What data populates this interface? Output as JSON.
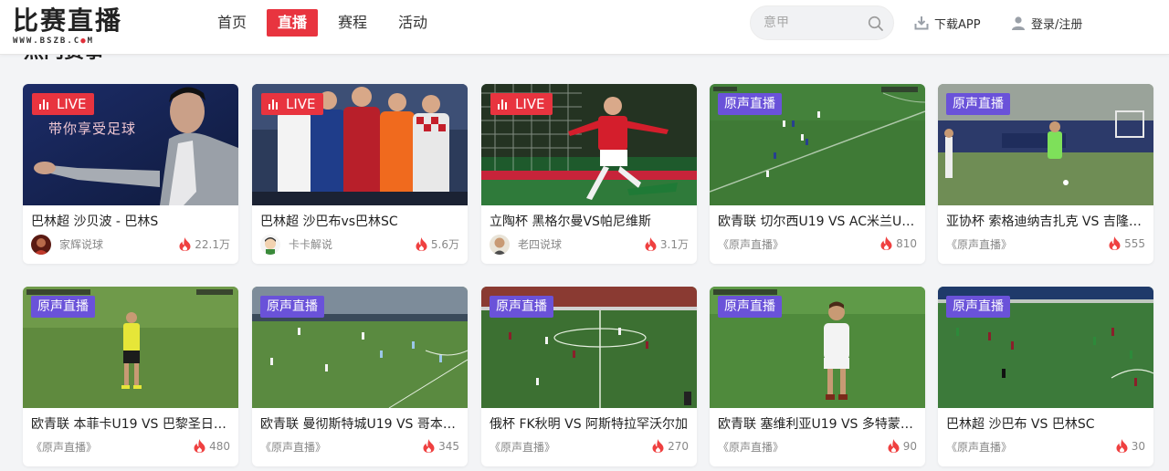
{
  "header": {
    "logo_title": "比赛直播",
    "logo_url_a": "WWW.BSZB.C",
    "logo_url_dot": "●",
    "logo_url_b": "M",
    "nav": [
      "首页",
      "直播",
      "赛程",
      "活动"
    ],
    "active_nav": "直播",
    "search_placeholder": "意甲",
    "download_label": "下载APP",
    "login_label": "登录/注册"
  },
  "section": {
    "title": "热门赛事"
  },
  "badges": {
    "live": "LIVE",
    "original": "原声直播"
  },
  "cards": [
    {
      "title": "巴林超 沙贝波 - 巴林S",
      "anchor": "家辉说球",
      "heat": "22.1万",
      "badge": "LIVE",
      "overlay": "带你享受足球",
      "avatar": "avatar-red"
    },
    {
      "title": "巴林超 沙巴布vs巴林SC",
      "anchor": "卡卡解说",
      "heat": "5.6万",
      "badge": "LIVE",
      "avatar": "avatar-cartoon"
    },
    {
      "title": "立陶杯 黑格尔曼VS帕尼维斯",
      "anchor": "老四说球",
      "heat": "3.1万",
      "badge": "LIVE",
      "avatar": "avatar-man"
    },
    {
      "title": "欧青联 切尔西U19 VS AC米兰U19",
      "anchor": "《原声直播》",
      "heat": "810",
      "badge": "原声直播"
    },
    {
      "title": "亚协杯 索格迪纳吉扎克 VS 吉隆…",
      "anchor": "《原声直播》",
      "heat": "555",
      "badge": "原声直播"
    },
    {
      "title": "欧青联 本菲卡U19 VS 巴黎圣日耳…",
      "anchor": "《原声直播》",
      "heat": "480",
      "badge": "原声直播"
    },
    {
      "title": "欧青联 曼彻斯特城U19 VS 哥本哈…",
      "anchor": "《原声直播》",
      "heat": "345",
      "badge": "原声直播"
    },
    {
      "title": "俄杯 FK秋明 VS 阿斯特拉罕沃尔加",
      "anchor": "《原声直播》",
      "heat": "270",
      "badge": "原声直播"
    },
    {
      "title": "欧青联 塞维利亚U19 VS 多特蒙德…",
      "anchor": "《原声直播》",
      "heat": "90",
      "badge": "原声直播"
    },
    {
      "title": "巴林超 沙巴布 VS 巴林SC",
      "anchor": "《原声直播》",
      "heat": "30",
      "badge": "原声直播"
    }
  ],
  "colors": {
    "accent": "#e8343f",
    "original_badge": "#6a52d9",
    "flame": "#ef4040"
  },
  "icons": {
    "search": "search-icon",
    "download": "download-icon",
    "user": "user-icon",
    "flame": "flame-icon",
    "live": "signal-bars-icon"
  }
}
